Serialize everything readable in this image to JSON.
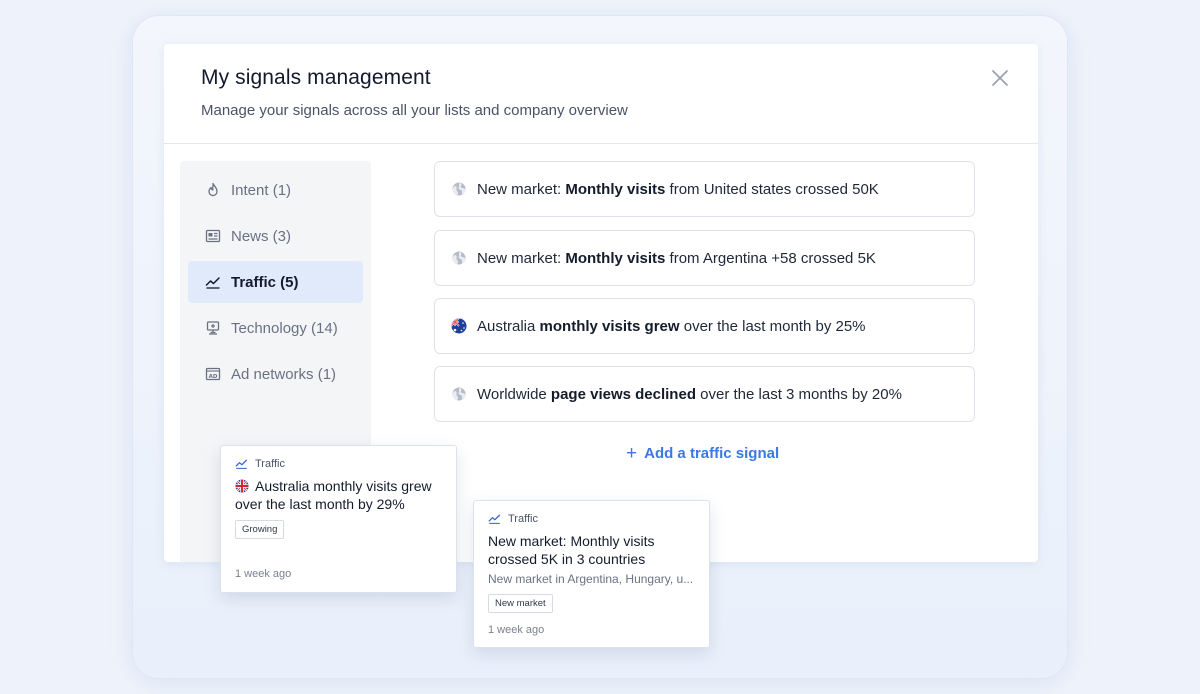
{
  "modal": {
    "title": "My signals management",
    "subtitle": "Manage your signals across all your lists and company overview"
  },
  "sidebar": {
    "items": [
      {
        "label": "Intent (1)",
        "icon": "flame-icon"
      },
      {
        "label": "News (3)",
        "icon": "newspaper-icon"
      },
      {
        "label": "Traffic (5)",
        "icon": "trend-line-icon",
        "active": true
      },
      {
        "label": "Technology (14)",
        "icon": "monitor-icon"
      },
      {
        "label": "Ad networks (1)",
        "icon": "ad-badge-icon"
      }
    ]
  },
  "signals": [
    {
      "icon": "globe-icon",
      "prefix": "New market: ",
      "bold": "Monthly visits",
      "suffix": " from United states crossed 50K"
    },
    {
      "icon": "globe-icon",
      "prefix": "New market: ",
      "bold": "Monthly visits",
      "suffix": " from Argentina +58 crossed 5K"
    },
    {
      "icon": "australia-flag-icon",
      "prefix": "Australia ",
      "bold": "monthly visits grew",
      "suffix": " over the last month by 25%"
    },
    {
      "icon": "globe-icon",
      "prefix": "Worldwide ",
      "bold": "page views declined",
      "suffix": " over the last 3 months by 20%"
    }
  ],
  "add_signal": {
    "plus": "+",
    "label": "Add a traffic signal"
  },
  "cards": [
    {
      "type": "Traffic",
      "flag": "uk-flag-icon",
      "title": "Australia monthly visits grew over the last month by 29%",
      "tag": "Growing",
      "time": "1 week ago"
    },
    {
      "type": "Traffic",
      "title": "New market: Monthly visits crossed 5K in 3 countries",
      "description": "New market in Argentina, Hungary, u...",
      "tag": "New market",
      "time": "1 week ago"
    }
  ],
  "colors": {
    "accent": "#3b78e6",
    "active_nav_bg": "#e1eafb",
    "background": "#eef3fb"
  }
}
